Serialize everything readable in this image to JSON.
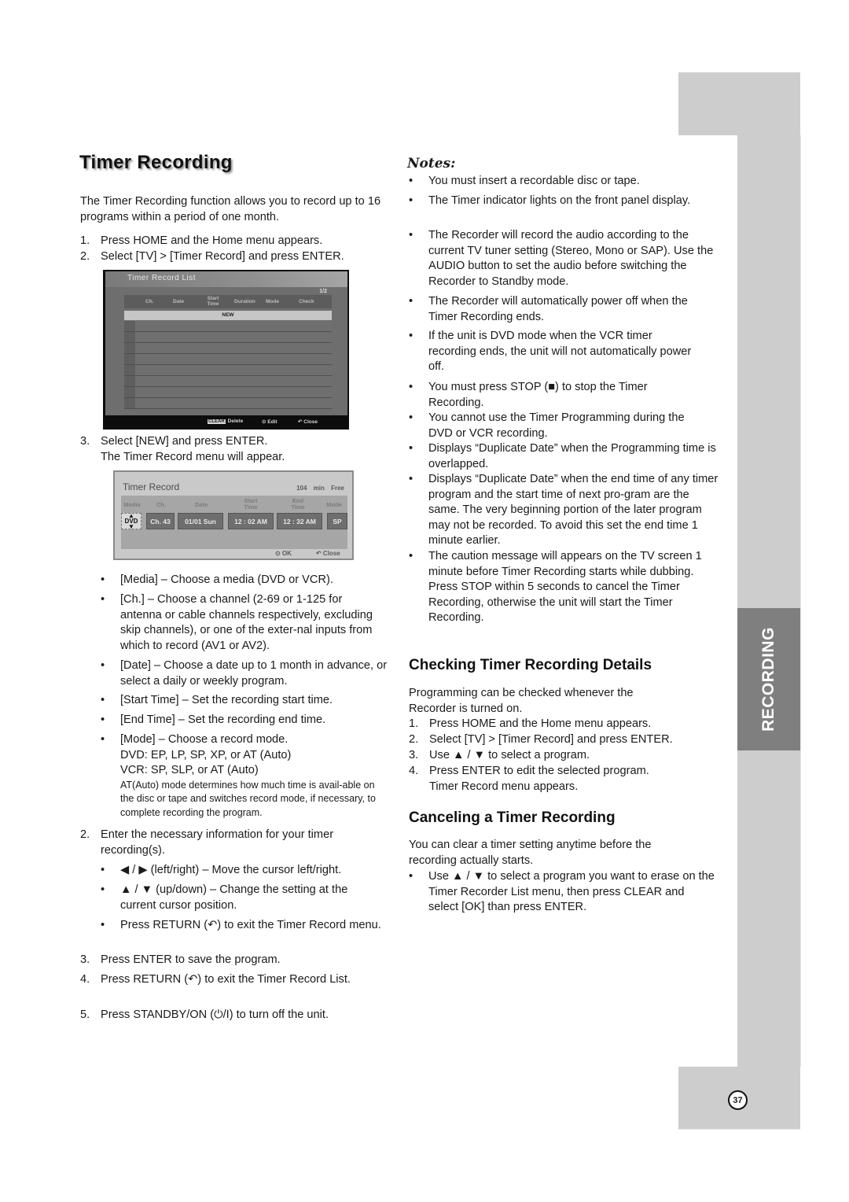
{
  "page": {
    "title": "Timer Recording",
    "intro": "The Timer Recording function allows you to record up to 16 programs within a period of one month.",
    "page_number": "37",
    "side_tab": "RECORDING"
  },
  "left": {
    "steps_a": [
      {
        "num": "1.",
        "text": "Press HOME and the Home menu appears."
      },
      {
        "num": "2.",
        "text": "Select [TV] > [Timer Record] and press ENTER."
      }
    ],
    "step3": {
      "num": "3.",
      "text": "Select [NEW] and press ENTER.",
      "subtext": "The Timer Record menu will appear."
    },
    "field_bullets": [
      "[Media] – Choose a media (DVD or VCR).",
      "[Ch.] – Choose a channel (2-69 or 1-125 for antenna or cable channels respectively, excluding skip channels), or one of the exter-nal inputs from which to record (AV1 or AV2).",
      "[Date] – Choose a date up to 1 month in advance, or select a daily or weekly program.",
      "[Start Time] – Set the recording start time.",
      "[End Time] – Set the recording end time."
    ],
    "mode_bullet": {
      "line1": "[Mode] – Choose a record mode.",
      "line2": "DVD: EP, LP, SP, XP, or AT (Auto)",
      "line3": "VCR: SP, SLP, or AT (Auto)",
      "note": "AT(Auto) mode determines how much time is avail-able on the disc or tape and switches record mode, if necessary, to complete recording the program."
    },
    "steps_b": {
      "step2": {
        "num": "2.",
        "text": "Enter the necessary information for your timer recording(s)."
      },
      "sub_bullets": [
        "◀ / ▶ (left/right) – Move the cursor left/right.",
        "▲ / ▼ (up/down) – Change the setting at the current cursor position.",
        "Press RETURN (↶) to exit the Timer Record menu."
      ],
      "step3": {
        "num": "3.",
        "text": "Press ENTER to save the program."
      },
      "step4": {
        "num": "4.",
        "text": "Press RETURN (↶) to exit the Timer Record List."
      },
      "step5": {
        "num": "5.",
        "text": "Press STANDBY/ON (⏻/I) to turn off the unit."
      }
    }
  },
  "timer_record_list_screen": {
    "title": "Timer Record List",
    "page_indicator": "1/2",
    "columns": [
      "Ch.",
      "Date",
      "Start Time",
      "Duration",
      "Mode",
      "Check"
    ],
    "new_row_label": "NEW",
    "empty_rows": 8,
    "footer": {
      "clear_key": "CLEAR",
      "delete": "Delete",
      "edit": "⊙ Edit",
      "close": "↶ Close"
    }
  },
  "timer_record_screen": {
    "title": "Timer Record",
    "free_space": "104 min Free",
    "labels": [
      "Media",
      "Ch.",
      "Date",
      "Start Time",
      "End Time",
      "Mode"
    ],
    "values": {
      "media": "DVD",
      "channel": "Ch. 43",
      "date": "01/01 Sun",
      "start_time": "12 : 02 AM",
      "end_time": "12 : 32 AM",
      "mode": "SP"
    },
    "footer": {
      "ok": "⊙ OK",
      "close": "↶ Close"
    }
  },
  "notes": {
    "heading": "Notes:",
    "items": [
      "You must insert a recordable disc or tape.",
      "The Timer indicator lights on the front panel display.",
      "The Recorder will record the audio according to the current TV tuner setting (Stereo, Mono or SAP). Use the AUDIO button to set the audio before switching the Recorder to Standby mode.",
      "The Recorder will automatically power off when the Timer Recording ends.",
      "If the unit is DVD mode when the VCR timer recording ends, the unit will not automatically power off.",
      "You must press STOP (■) to stop the Timer Recording.",
      "You cannot use the Timer Programming during the DVD or VCR recording.",
      "Displays “Duplicate Date” when the Programming time is overlapped.",
      "Displays “Duplicate Date” when the end time of any timer program and the start time of next pro-gram are the same. The very beginning portion of the later program may not be recorded. To avoid this set the end time 1 minute earlier.",
      "The caution message will appears on the TV screen 1 minute before Timer Recording starts while dubbing. Press STOP within 5 seconds to cancel the Timer Recording, otherwise the unit will start the Timer Recording."
    ]
  },
  "checking": {
    "heading": "Checking Timer Recording Details",
    "intro": "Programming can be checked whenever the Recorder is turned on.",
    "steps": [
      {
        "num": "1.",
        "text": "Press HOME and the Home menu appears."
      },
      {
        "num": "2.",
        "text": "Select [TV] > [Timer Record] and press ENTER."
      },
      {
        "num": "3.",
        "text": "Use ▲ / ▼ to select a program."
      },
      {
        "num": "4.",
        "text": "Press ENTER to edit the selected program. Timer Record menu appears."
      }
    ]
  },
  "canceling": {
    "heading": "Canceling a Timer Recording",
    "intro": "You can clear a timer setting anytime before the recording actually starts.",
    "bullet": "Use ▲ / ▼ to select a program you want to erase on the Timer Recorder List menu, then press CLEAR and select [OK] than press ENTER."
  },
  "bullet_char": "•"
}
